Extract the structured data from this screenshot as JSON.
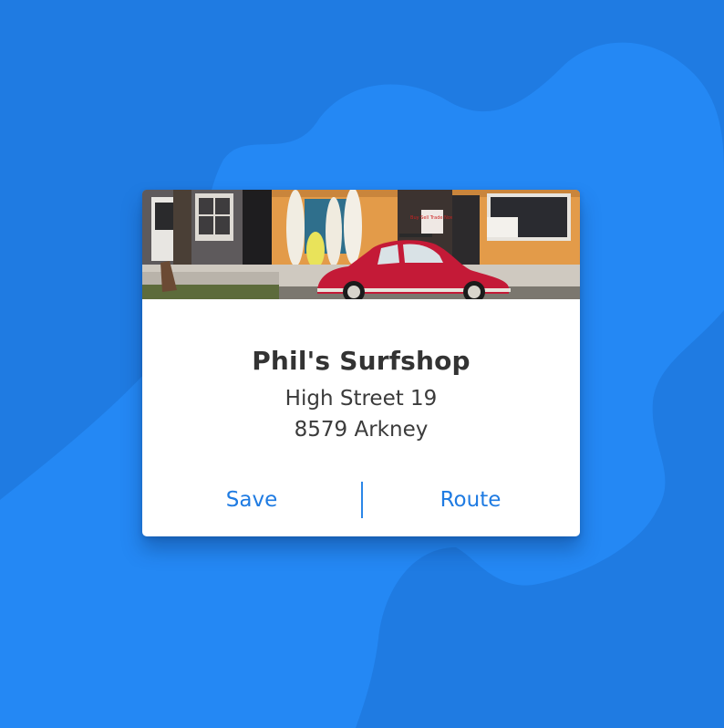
{
  "card": {
    "title": "Phil's Surfshop",
    "address_line1": "High Street 19",
    "address_line2": "8579 Arkney"
  },
  "actions": {
    "save_label": "Save",
    "route_label": "Route"
  },
  "colors": {
    "background": "#1f7be2",
    "background_shape": "#2488f4",
    "accent": "#1f7be2",
    "card": "#ffffff",
    "text": "#333333"
  },
  "photo": {
    "sign_text": "Buy Sell Trade Now"
  }
}
